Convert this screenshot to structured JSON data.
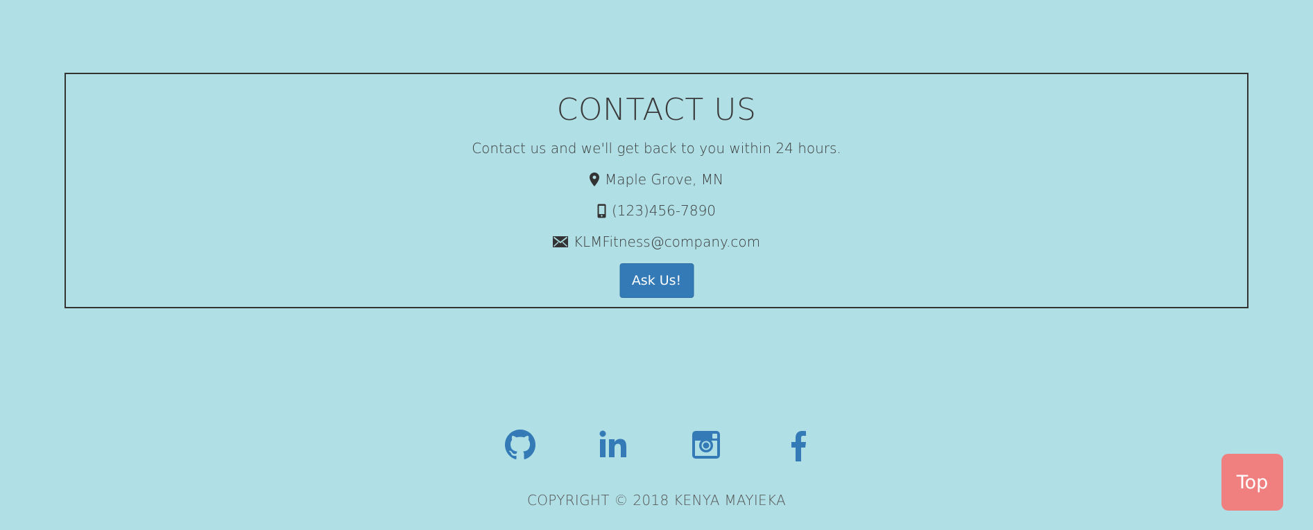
{
  "contact": {
    "title": "CONTACT US",
    "subtitle": "Contact us and we'll get back to you within 24 hours.",
    "location": "Maple Grove, MN",
    "phone": "(123)456-7890",
    "email": "KLMFitness@company.com",
    "button_label": "Ask Us!"
  },
  "social": {
    "icons": [
      "github-icon",
      "linkedin-icon",
      "instagram-icon",
      "facebook-icon"
    ],
    "icon_color": "#337ab7"
  },
  "footer": {
    "copyright": "COPYRIGHT © 2018 KENYA MAYIEKA"
  },
  "top_button": {
    "label": "Top",
    "color": "#f08080"
  },
  "colors": {
    "background": "#b0dfe5",
    "text": "#333333",
    "primary_button": "#337ab7"
  }
}
